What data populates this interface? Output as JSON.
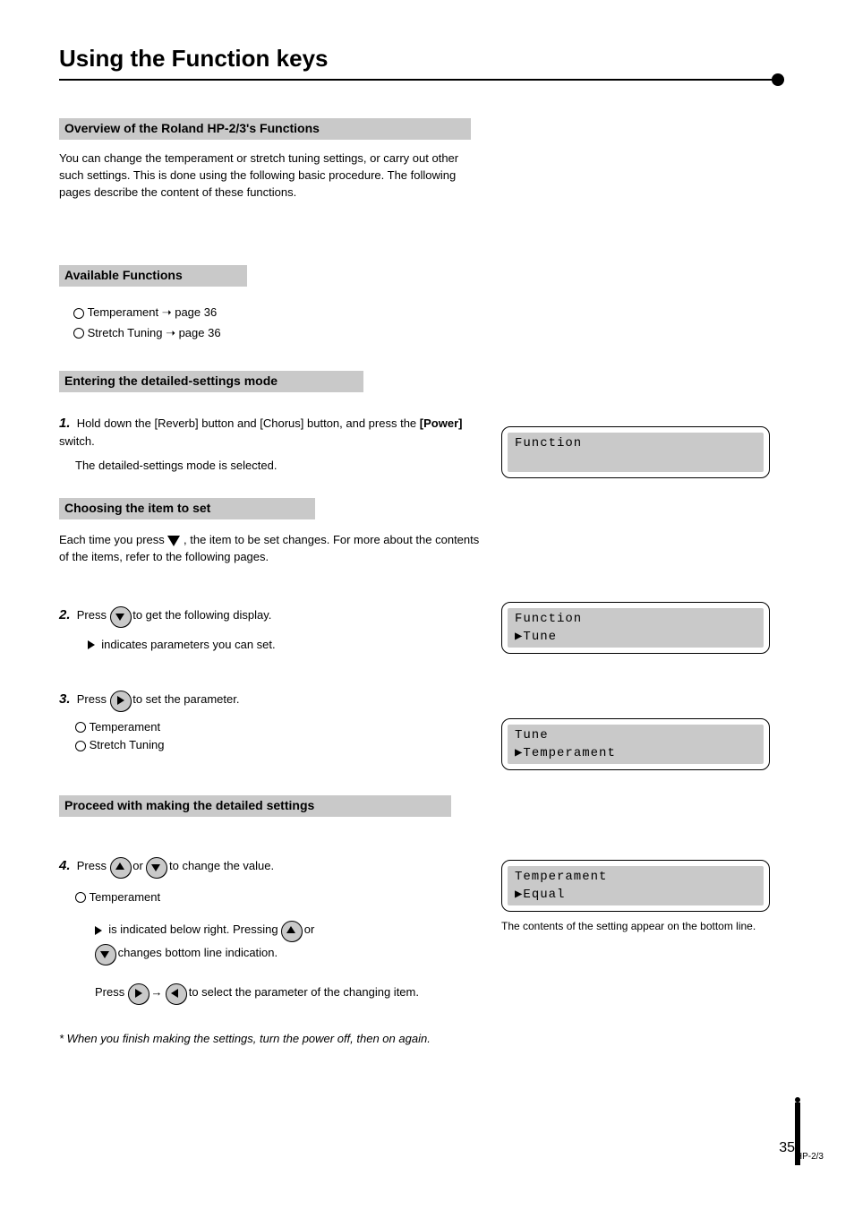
{
  "page": {
    "title": "Using the Function keys",
    "number": "35",
    "thumb_label": "HP-2/3"
  },
  "sections": {
    "s1": {
      "heading": "Overview of the Roland HP-2/3's Functions",
      "body": "You can change the temperament or stretch tuning settings, or carry out other such settings. This is done using the following basic procedure. The following pages describe the content of these functions."
    },
    "s2": {
      "heading": "Available Functions",
      "items": [
        "Temperament ➝ page 36",
        "Stretch Tuning ➝ page 36"
      ]
    },
    "s3": {
      "heading": "Entering the detailed-settings mode",
      "step_num": "1.",
      "step_text_before": "Hold down the [Reverb] button and [Chorus] button, and press the ",
      "step_power_btn": "[Power]",
      "step_text_after": " switch.",
      "step_note": "The detailed-settings mode is selected."
    },
    "s4": {
      "heading": "Choosing the item to set",
      "intro_before": "Each time you press ",
      "intro_after": ", the item to be set changes. For more about the contents of the items, refer to the following pages.",
      "step2_num": "2.",
      "step2_before": "Press ",
      "step2_after": " to get the following display.",
      "step2_arrow_note": "indicates parameters you can set.",
      "step3_num": "3.",
      "step3_before": "Press ",
      "step3_after": " to set the parameter.",
      "step3_bullets": [
        "Temperament",
        "Stretch Tuning"
      ]
    },
    "s5": {
      "heading": "Proceed with making the detailed settings",
      "step4_num": "4.",
      "step4_before": "Press ",
      "step4_mid": " or ",
      "step4_after": " to change the value.",
      "step4_sub_bullet": "Temperament",
      "step4_sub_text_before": "is indicated below right. Pressing ",
      "step4_sub_text_mid": " or ",
      "step4_sub_text_after": " changes bottom line indication.",
      "step4_sub_text2_before": "Press ",
      "step4_sub_text2_mid": " → ",
      "step4_sub_text2_after": " to select the parameter of the changing item.",
      "step5_note": "* When you finish making the settings, turn the power off, then on again."
    }
  },
  "lcds": {
    "l1": {
      "line1": "Function",
      "line2": ""
    },
    "l2": {
      "line1": "Function",
      "line2": "▶Tune"
    },
    "l3": {
      "line1": " Tune",
      "line2": "▶Temperament"
    },
    "l4": {
      "line1": " Temperament",
      "line2": "▶Equal"
    }
  },
  "right_texts": {
    "r4": "The contents of the setting appear on the bottom line."
  }
}
